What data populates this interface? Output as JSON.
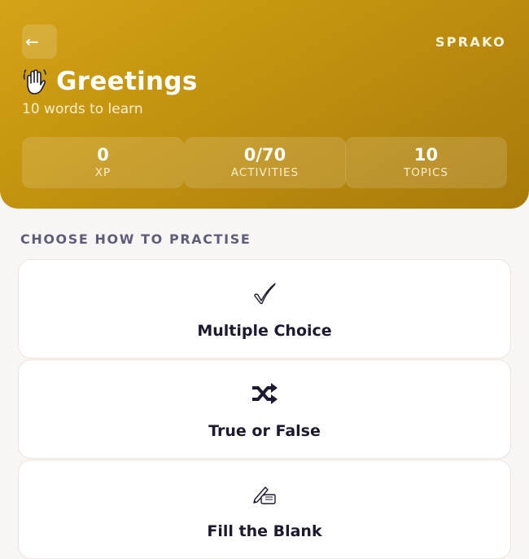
{
  "header": {
    "back_label": "←",
    "brand": "SPRAKO",
    "title": "Greetings",
    "title_icon": "waving-hand-icon",
    "subtitle": "10 words to learn",
    "gradient_colors": [
      "#d5a317",
      "#a87a0b"
    ]
  },
  "stats": [
    {
      "value": "0",
      "label": "XP"
    },
    {
      "value": "0/70",
      "label": "ACTIVITIES"
    },
    {
      "value": "10",
      "label": "TOPICS"
    }
  ],
  "section_title": "CHOOSE HOW TO PRACTISE",
  "modes": [
    {
      "label": "Multiple Choice",
      "icon": "checkmark-icon"
    },
    {
      "label": "True or False",
      "icon": "shuffle-icon"
    },
    {
      "label": "Fill the Blank",
      "icon": "writing-hand-icon"
    }
  ]
}
